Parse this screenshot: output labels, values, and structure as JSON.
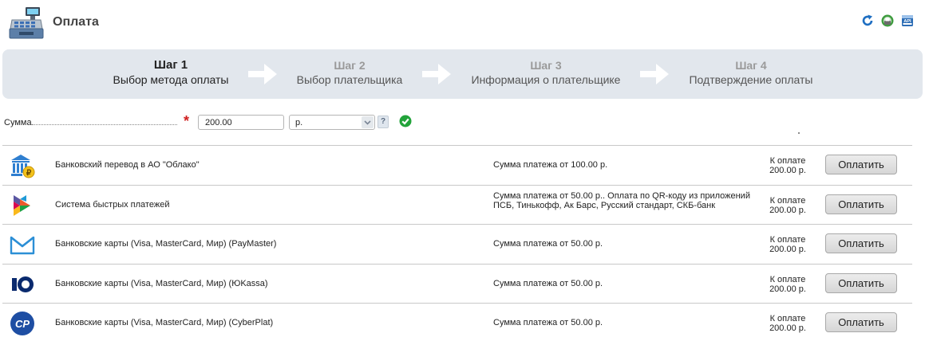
{
  "header": {
    "title": "Оплата",
    "app_icon": "cash-register-icon",
    "tools": [
      {
        "name": "refresh-icon"
      },
      {
        "name": "print-icon"
      },
      {
        "name": "api-icon",
        "label": "API"
      }
    ]
  },
  "steps": [
    {
      "num": "Шаг 1",
      "label": "Выбор метода оплаты",
      "active": true
    },
    {
      "num": "Шаг 2",
      "label": "Выбор плательщика",
      "active": false
    },
    {
      "num": "Шаг 3",
      "label": "Информация о плательщике",
      "active": false
    },
    {
      "num": "Шаг 4",
      "label": "Подтверждение оплаты",
      "active": false
    }
  ],
  "amount": {
    "label": "Сумма",
    "required_mark": "*",
    "value": "200.00",
    "currency": "р.",
    "help": "?"
  },
  "methods": [
    {
      "name": "Банковский перевод в АО \"Облако\"",
      "desc": "Сумма платежа от 100.00 р.",
      "topay_label": "К оплате",
      "topay_amount": "200.00 р.",
      "button": "Оплатить",
      "icon": "bank-transfer-icon"
    },
    {
      "name": "Система быстрых платежей",
      "desc": "Сумма платежа от 50.00 р.. Оплата по QR-коду из приложений ПСБ, Тинькофф, Ак Барс, Русский стандарт, СКБ-банк",
      "topay_label": "К оплате",
      "topay_amount": "200.00 р.",
      "button": "Оплатить",
      "icon": "sbp-icon"
    },
    {
      "name": "Банковские карты (Visa, MasterCard, Мир) (PayMaster)",
      "desc": "Сумма платежа от 50.00 р.",
      "topay_label": "К оплате",
      "topay_amount": "200.00 р.",
      "button": "Оплатить",
      "icon": "paymaster-icon"
    },
    {
      "name": "Банковские карты (Visa, MasterCard, Мир) (ЮKassa)",
      "desc": "Сумма платежа от 50.00 р.",
      "topay_label": "К оплате",
      "topay_amount": "200.00 р.",
      "button": "Оплатить",
      "icon": "yookassa-icon"
    },
    {
      "name": "Банковские карты (Visa, MasterCard, Мир) (CyberPlat)",
      "desc": "Сумма платежа от 50.00 р.",
      "topay_label": "К оплате",
      "topay_amount": "200.00 р.",
      "button": "Оплатить",
      "icon": "cyberplat-icon"
    }
  ]
}
